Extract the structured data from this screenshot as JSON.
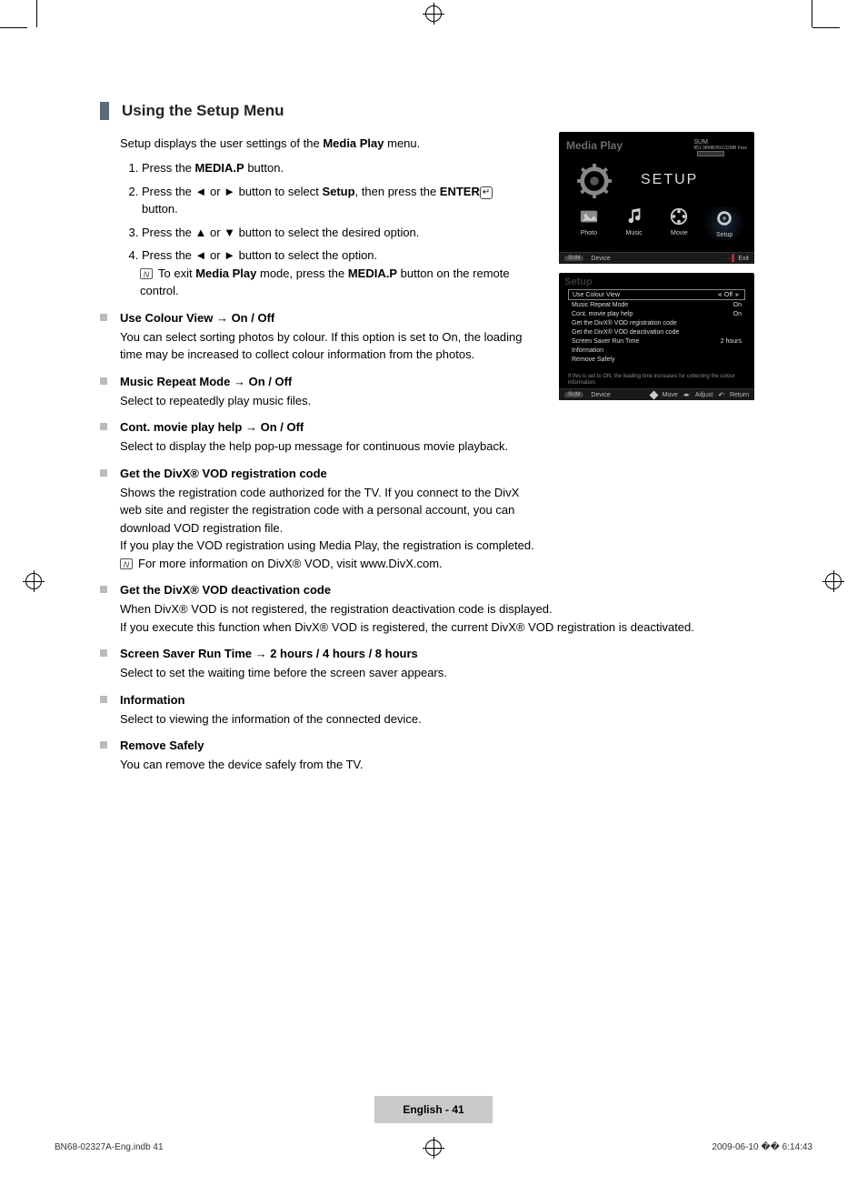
{
  "section_title": "Using the Setup Menu",
  "intro_pre": "Setup displays the user settings of the ",
  "intro_bold": "Media Play",
  "intro_post": " menu.",
  "steps": {
    "s1_pre": "Press the ",
    "s1_bold": "MEDIA.P",
    "s1_post": " button.",
    "s2_pre": "Press the ◄ or ► button to select ",
    "s2_bold1": "Setup",
    "s2_mid": ", then press the ",
    "s2_bold2": "ENTER",
    "s2_post": " button.",
    "s3": "Press the ▲ or ▼ button to select the desired option.",
    "s4": "Press the ◄ or ► button to select the option.",
    "s4_note_pre": "To exit ",
    "s4_note_bold1": "Media Play",
    "s4_note_mid": " mode, press the ",
    "s4_note_bold2": "MEDIA.P",
    "s4_note_post": " button on the remote control."
  },
  "items": [
    {
      "title": "Use Colour View → On / Off",
      "text": "You can select sorting photos by colour. If this option is set to On, the loading time may be increased to collect colour information from the photos."
    },
    {
      "title": "Music Repeat Mode → On / Off",
      "text": "Select to repeatedly play music files."
    },
    {
      "title": "Cont. movie play help → On / Off",
      "text": "Select to display the help pop-up message for continuous movie playback."
    },
    {
      "title": "Get the DivX® VOD registration code",
      "text": "Shows the registration code authorized for the TV. If you connect to the DivX web site and register the registration code with a personal account, you can download VOD registration file.",
      "text2": "If you play the VOD registration using Media Play, the registration is completed.",
      "note": "For more information on DivX® VOD, visit www.DivX.com."
    },
    {
      "title": "Get the DivX® VOD deactivation code",
      "text": "When DivX® VOD is not registered, the registration deactivation code is displayed.",
      "text2": "If you execute this function when DivX® VOD is registered, the current DivX® VOD registration is deactivated."
    },
    {
      "title": "Screen Saver Run Time → 2 hours / 4 hours / 8 hours",
      "text": "Select to set the waiting time before the screen saver appears."
    },
    {
      "title": "Information",
      "text": "Select to viewing the information of the connected device."
    },
    {
      "title": "Remove Safely",
      "text": "You can remove the device safely from the TV."
    }
  ],
  "shot1": {
    "title": "Media Play",
    "sum": "SUM",
    "device_label": "851.98MB/993.02MB Free",
    "heading": "SETUP",
    "modes": [
      "Photo",
      "Music",
      "Movie",
      "Setup"
    ],
    "bar_sum": "SUM",
    "bar_device": "Device",
    "bar_exit": "Exit"
  },
  "shot2": {
    "watermark": "Setup",
    "rows": [
      {
        "l": "Use Colour View",
        "r": "Off",
        "arrows": true,
        "sel": true
      },
      {
        "l": "Music Repeat Mode",
        "r": "On"
      },
      {
        "l": "Cont. movie play help",
        "r": "On"
      },
      {
        "l": "Get the DivX® VOD registration code",
        "r": ""
      },
      {
        "l": "Get the DivX® VOD deactivation code",
        "r": ""
      },
      {
        "l": "Screen Saver Run Time",
        "r": "2 hours"
      },
      {
        "l": "Information",
        "r": ""
      },
      {
        "l": "Remove Safely",
        "r": ""
      }
    ],
    "note": "If this is set to ON, the loading time increases for collecting the colour information.",
    "bar_sum": "SUM",
    "bar_device": "Device",
    "bar_move": "Move",
    "bar_adjust": "Adjust",
    "bar_return": "Return"
  },
  "page_number": "English - 41",
  "footer_left": "BN68-02327A-Eng.indb   41",
  "footer_right": "2009-06-10   �� 6:14:43",
  "enter_glyph": "↵",
  "note_glyph": "N"
}
